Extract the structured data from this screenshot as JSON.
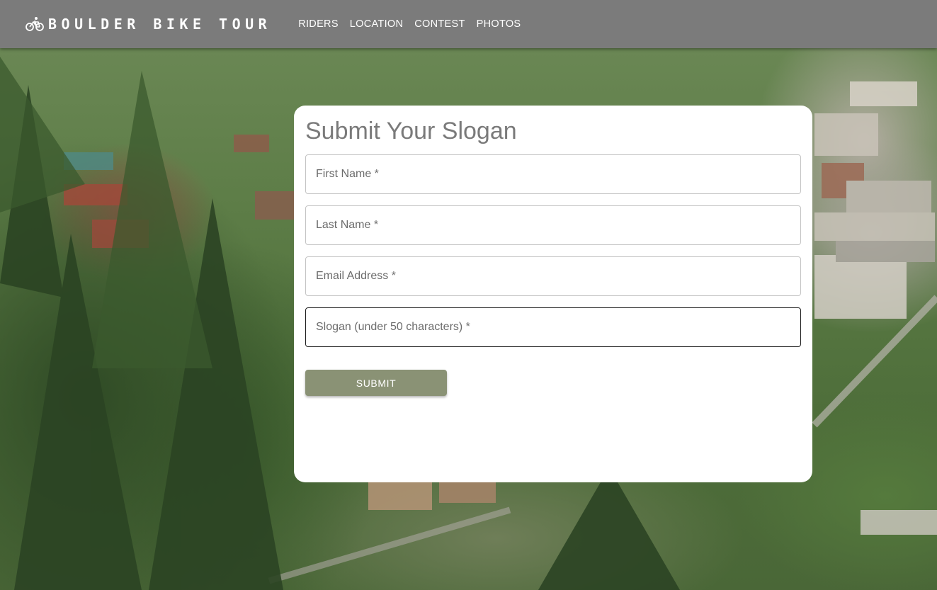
{
  "navbar": {
    "brand": "BOULDER BIKE TOUR",
    "brand_icon": "bicycle-icon",
    "links": [
      "RIDERS",
      "LOCATION",
      "CONTEST",
      "PHOTOS"
    ]
  },
  "form": {
    "title": "Submit Your Slogan",
    "fields": [
      {
        "label": "First Name *",
        "value": ""
      },
      {
        "label": "Last Name *",
        "value": ""
      },
      {
        "label": "Email Address *",
        "value": ""
      },
      {
        "label": "Slogan (under 50 characters) *",
        "value": "",
        "focused": true
      }
    ],
    "submit_label": "SUBMIT"
  },
  "colors": {
    "navbar_bg": "#7b7b7b",
    "submit_bg": "#8a9275",
    "title_text": "#7a7a7a",
    "card_bg": "#ffffff"
  }
}
